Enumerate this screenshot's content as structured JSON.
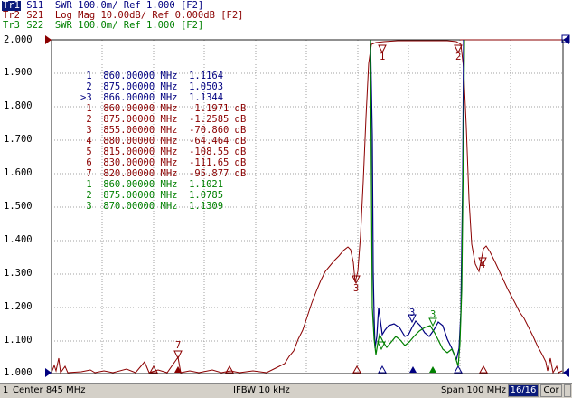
{
  "traces": [
    {
      "name": "Tr1",
      "desc": " S11  SWR 100.0m/ Ref 1.000 [F2]",
      "color": "#000080"
    },
    {
      "name": "Tr2",
      "desc": " S21  Log Mag 10.00dB/ Ref 0.000dB [F2]",
      "color": "#8b0000"
    },
    {
      "name": "Tr3",
      "desc": " S22  SWR 100.0m/ Ref 1.000 [F2]",
      "color": "#008000"
    }
  ],
  "yaxis": {
    "ticks": [
      "2.000",
      "1.900",
      "1.800",
      "1.700",
      "1.600",
      "1.500",
      "1.400",
      "1.300",
      "1.200",
      "1.100",
      "1.000"
    ]
  },
  "markers": {
    "tr1": [
      " 1  860.00000 MHz  1.1164",
      " 2  875.00000 MHz  1.0503",
      ">3  866.00000 MHz  1.1344"
    ],
    "tr2": [
      " 1  860.00000 MHz  -1.1971 dB",
      " 2  875.00000 MHz  -1.2585 dB",
      " 3  855.00000 MHz  -70.860 dB",
      " 4  880.00000 MHz  -64.464 dB",
      " 5  815.00000 MHz  -108.55 dB",
      " 6  830.00000 MHz  -111.65 dB",
      " 7  820.00000 MHz  -95.877 dB"
    ],
    "tr3": [
      " 1  860.00000 MHz  1.1021",
      " 2  875.00000 MHz  1.0785",
      " 3  870.00000 MHz  1.1309"
    ]
  },
  "plot_markers": {
    "m1": "1",
    "m2": "2",
    "m3": "3",
    "m4": "4",
    "m7": "7",
    "t3a": "3",
    "t3b": "3"
  },
  "status": {
    "channel": "1",
    "center": "Center 845 MHz",
    "ifbw": "IFBW 10 kHz",
    "span": "Span 100 MHz",
    "count": "16/16",
    "cor": "Cor"
  },
  "colors": {
    "tr1": "#000080",
    "tr2": "#8b0000",
    "tr3": "#008000"
  }
}
